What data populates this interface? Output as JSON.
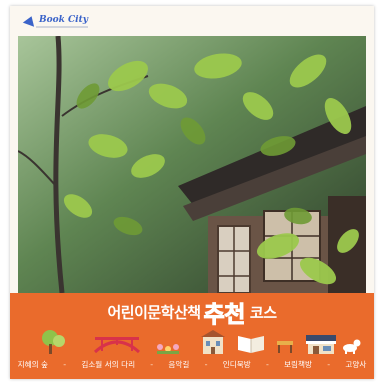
{
  "logo": {
    "name": "Book City"
  },
  "title": {
    "prefix": "어린이문학산책",
    "highlight": "추천",
    "suffix": "코스"
  },
  "route": {
    "stops": [
      "지혜의 숲",
      "김소월 서의 다리",
      "음악길",
      "인디북방",
      "보림책방",
      "고양사"
    ],
    "separator": "-"
  },
  "icons": [
    "tree-icon",
    "bridge-icon",
    "flowers-icon",
    "building-icon",
    "open-book-icon",
    "bench-icon",
    "shop-icon",
    "dog-icon"
  ],
  "colors": {
    "band": "#ea6b2c",
    "highlight": "#ffe8a8",
    "logo": "#3a63c9",
    "paper": "#fbf7f0"
  }
}
